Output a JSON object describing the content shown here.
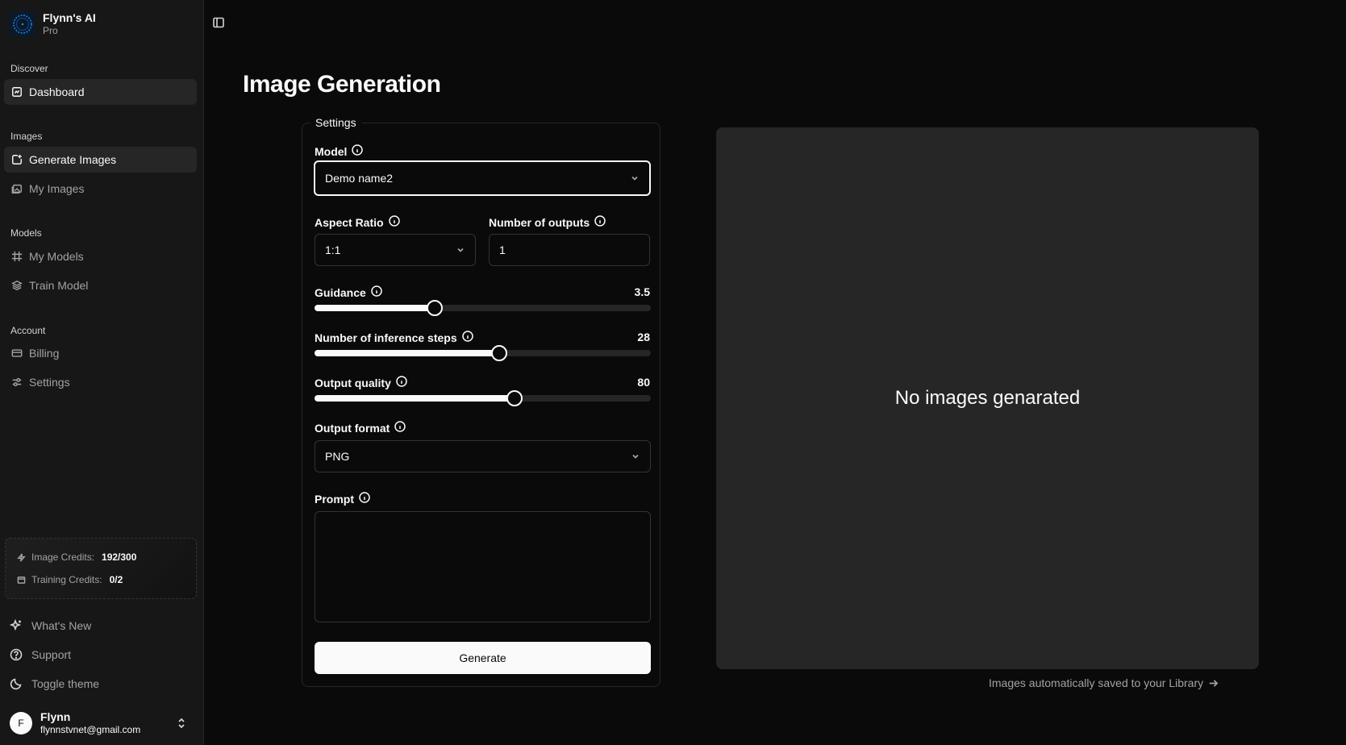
{
  "brand": {
    "name": "Flynn's AI",
    "plan": "Pro",
    "logo_icon": "circle-logo-icon"
  },
  "sidebar": {
    "groups": {
      "discover": "Discover",
      "images": "Images",
      "models": "Models",
      "account": "Account"
    },
    "items": {
      "dashboard": "Dashboard",
      "generate_images": "Generate Images",
      "my_images": "My Images",
      "my_models": "My Models",
      "train_model": "Train Model",
      "billing": "Billing",
      "settings": "Settings"
    },
    "active": "generate_images",
    "credits": {
      "image_label": "Image Credits:",
      "image_value": "192/300",
      "training_label": "Training Credits:",
      "training_value": "0/2"
    },
    "bottom": {
      "whats_new": "What's New",
      "support": "Support",
      "toggle_theme": "Toggle theme"
    },
    "user": {
      "initial": "F",
      "name": "Flynn",
      "email": "flynnstvnet@gmail.com"
    }
  },
  "main": {
    "title": "Image Generation",
    "settings": {
      "legend": "Settings",
      "model": {
        "label": "Model",
        "value": "Demo name2"
      },
      "aspect_ratio": {
        "label": "Aspect Ratio",
        "value": "1:1"
      },
      "num_outputs": {
        "label": "Number of outputs",
        "value": "1"
      },
      "guidance": {
        "label": "Guidance",
        "value": "3.5",
        "fraction": 0.357
      },
      "inference_steps": {
        "label": "Number of inference steps",
        "value": "28",
        "fraction": 0.548
      },
      "output_quality": {
        "label": "Output quality",
        "value": "80",
        "fraction": 0.594
      },
      "output_format": {
        "label": "Output format",
        "value": "PNG"
      },
      "prompt": {
        "label": "Prompt",
        "value": ""
      },
      "generate_label": "Generate"
    },
    "preview": {
      "empty_text": "No images genarated",
      "library_link": "Images automatically saved to your Library"
    }
  },
  "colors": {
    "background": "#0a0a0a",
    "sidebar": "#171717",
    "active_item": "#262626",
    "preview": "#262626",
    "text": "#fafafa",
    "muted": "#a3a3a3"
  }
}
